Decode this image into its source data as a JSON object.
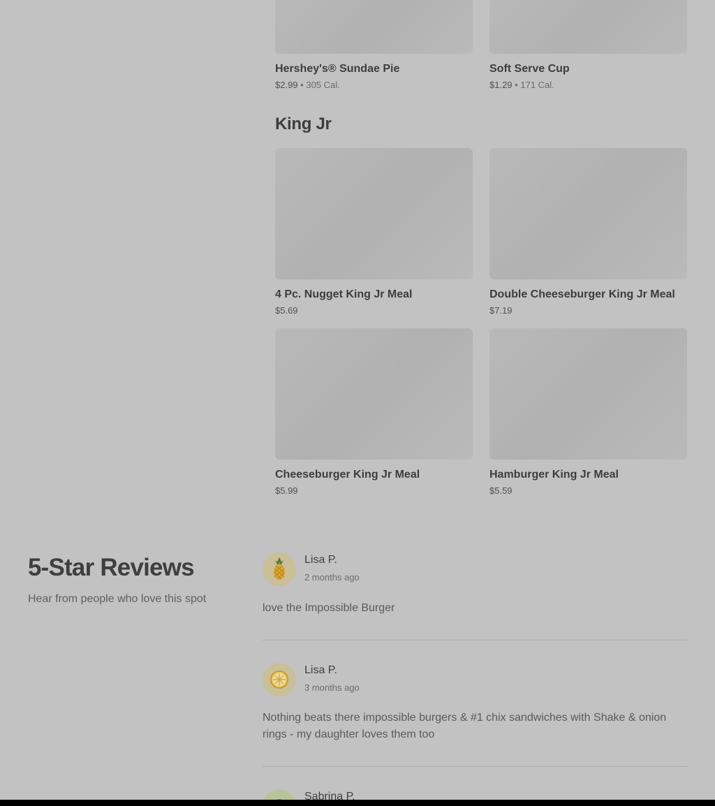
{
  "menu": {
    "top_items": [
      {
        "name": "Hershey's® Sundae Pie",
        "price": "$2.99",
        "calories": "305 Cal."
      },
      {
        "name": "Soft Serve Cup",
        "price": "$1.29",
        "calories": "171 Cal."
      }
    ],
    "king_jr": {
      "title": "King Jr",
      "items": [
        {
          "name": "4 Pc. Nugget King Jr Meal",
          "price": "$5.69"
        },
        {
          "name": "Double Cheeseburger King Jr Meal",
          "price": "$7.19"
        },
        {
          "name": "Cheeseburger King Jr Meal",
          "price": "$5.99"
        },
        {
          "name": "Hamburger King Jr Meal",
          "price": "$5.59"
        }
      ]
    },
    "meta_separator": "•"
  },
  "reviews": {
    "title": "5-Star Reviews",
    "subtitle": "Hear from people who love this spot",
    "items": [
      {
        "author": "Lisa P.",
        "date": "2 months ago",
        "text": "love the Impossible Burger",
        "avatar_icon": "pineapple-icon"
      },
      {
        "author": "Lisa P.",
        "date": "3 months ago",
        "text": "Nothing beats there impossible burgers & #1 chix sandwiches with Shake & onion rings - my daughter loves them too",
        "avatar_icon": "citrus-slice-icon"
      },
      {
        "author": "Sabrina P.",
        "date": "",
        "text": "",
        "avatar_icon": "avocado-icon"
      }
    ]
  },
  "colors": {
    "overlay_background": "#c2c2c2",
    "avatar_background": "#cbbf98"
  }
}
